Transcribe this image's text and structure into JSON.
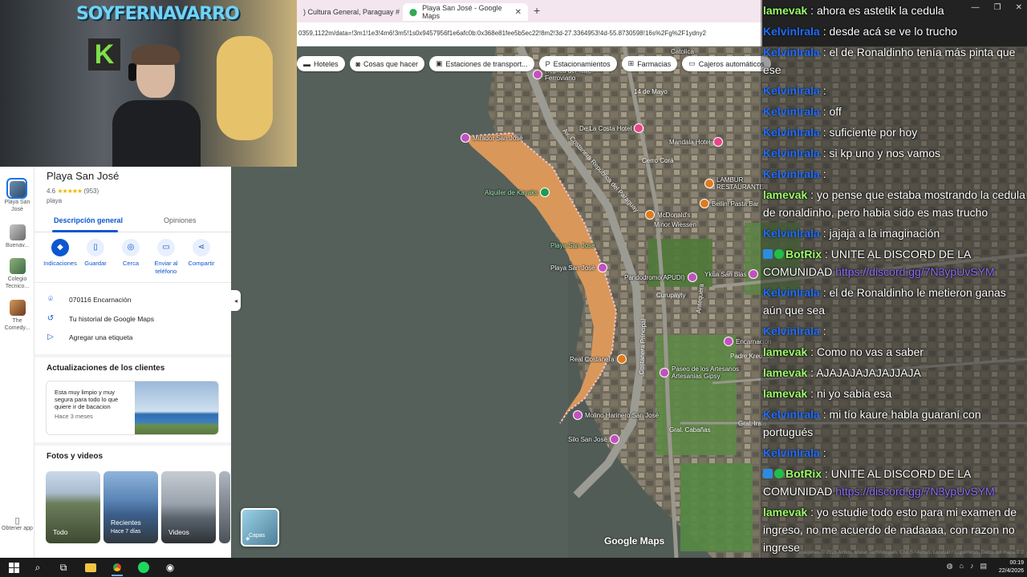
{
  "browser": {
    "tabs": [
      {
        "label": ") Cultura General, Paraguay #"
      },
      {
        "label": "Playa San José - Google Maps"
      }
    ],
    "url": "0359,1122m/data=!3m1!1e3!4m6!3m5!1s0x9457956f1e6afc0b:0x368e81fee5b5ec22!8m2!3d-27.3364953!4d-55.8730598!16s%2Fg%2F1ydny2"
  },
  "chips": [
    {
      "icon": "bed-icon",
      "label": "Hoteles"
    },
    {
      "icon": "camera-icon",
      "label": "Cosas que hacer"
    },
    {
      "icon": "transit-icon",
      "label": "Estaciones de transport..."
    },
    {
      "icon": "parking-icon",
      "label": "Estacionamientos"
    },
    {
      "icon": "pharmacy-icon",
      "label": "Farmacias"
    },
    {
      "icon": "atm-icon",
      "label": "Cajeros automáticos"
    }
  ],
  "webcam": {
    "graffiti": "SOYFERNAVARRO",
    "letter": "K"
  },
  "rail": [
    {
      "label": "Playa San José"
    },
    {
      "label": "Buenav..."
    },
    {
      "label": "Colegio Tecnico..."
    },
    {
      "label": "The Comedy..."
    },
    {
      "label": "Obtener app"
    }
  ],
  "place": {
    "title": "Playa San José",
    "rating": "4.6",
    "stars": "★★★★★",
    "reviews": "(953)",
    "type": "playa",
    "tabs": [
      "Descripción general",
      "Opiniones"
    ],
    "actions": [
      "Indicaciones",
      "Guardar",
      "Cerca",
      "Enviar al teléfono",
      "Compartir"
    ],
    "address": "070116 Encarnación",
    "history": "Tu historial de Google Maps",
    "label_action": "Agregar una etiqueta",
    "updates_heading": "Actualizaciones de los clientes",
    "review_text": "Esta muy limpio y muy segura para todo lo que quiere ir de bacacion",
    "review_time": "Hace 3 meses",
    "photos_heading": "Fotos y videos",
    "photos": [
      {
        "label": "Todo",
        "sub": ""
      },
      {
        "label": "Recientes",
        "sub": "Hace 7 días"
      },
      {
        "label": "Videos",
        "sub": ""
      }
    ]
  },
  "map": {
    "pois": [
      {
        "label": "Mirador San José"
      },
      {
        "label": "De La Costa Hotel"
      },
      {
        "label": "Mandala Hotel"
      },
      {
        "label": "Alquiler de Kayaks"
      },
      {
        "label": "LAMBUR RESTAURANTE"
      },
      {
        "label": "Bellini Pasta Bar"
      },
      {
        "label": "McDonald's"
      },
      {
        "label": "Minor Wiessen"
      },
      {
        "label": "Playa San José"
      },
      {
        "label": "Pandodromo(APUDI)"
      },
      {
        "label": "Ykua San Blas"
      },
      {
        "label": "Real Costanera"
      },
      {
        "label": "Paseo de los Artesanos Artesanias Gipsy"
      },
      {
        "label": "Encarnación"
      },
      {
        "label": "Molino Harinero San José"
      },
      {
        "label": "Silo San José"
      },
      {
        "label": "Catolica"
      },
      {
        "label": "Réplica del Taller Ferroviario"
      }
    ],
    "streets": [
      "Av. Costanera República del Paraguay",
      "14 de Mayo",
      "Cerro Corá",
      "Curupayty",
      "Costanera Principal",
      "Padre Kreusser",
      "Gral. Cabañas",
      "Antequera",
      "Gral. Irala"
    ],
    "brand": "Google Maps",
    "attribution": "Imágenes © 2026 Airbus, Maxar Technologies, CNES / Airbus, Landsat / Copernicus, Datos del mapa © 2",
    "layers": "Capas"
  },
  "chat": {
    "messages": [
      {
        "user": "lamevak",
        "color": "green",
        "text": "ahora es astetik la cedula"
      },
      {
        "user": "Kelvinlrala",
        "color": "blue",
        "text": "desde acá se ve lo trucho"
      },
      {
        "user": "Kelvinlrala",
        "color": "blue",
        "text": "el de Ronaldinho tenía más pinta que ese"
      },
      {
        "user": "Kelvinlrala",
        "color": "blue",
        "text": ""
      },
      {
        "user": "Kelvinlrala",
        "color": "blue",
        "text": "off"
      },
      {
        "user": "Kelvinlrala",
        "color": "blue",
        "text": "suficiente por hoy"
      },
      {
        "user": "Kelvinlrala",
        "color": "blue",
        "text": "si kp uno y nos vamos"
      },
      {
        "user": "Kelvinlrala",
        "color": "blue",
        "text": ""
      },
      {
        "user": "lamevak",
        "color": "green",
        "text": "yo pense que estaba mostrando la cedula de ronaldinho, pero habia sido es mas trucho"
      },
      {
        "user": "Kelvinlrala",
        "color": "blue",
        "text": "jajaja a la imaginación"
      },
      {
        "user": "BotRix",
        "color": "bot",
        "text": "UNITE AL DISCORD DE LA COMUNIDAD ",
        "link": "https://discord.gg/7N3ypUvSYM"
      },
      {
        "user": "Kelvinlrala",
        "color": "blue",
        "text": "el de Ronaldinho le metieron ganas aún que sea"
      },
      {
        "user": "Kelvinlrala",
        "color": "blue",
        "text": ""
      },
      {
        "user": "lamevak",
        "color": "green",
        "text": "Como no vas a saber"
      },
      {
        "user": "lamevak",
        "color": "green",
        "text": "AJAJAJAJAJAJJAJA"
      },
      {
        "user": "lamevak",
        "color": "green",
        "text": "ni yo sabia esa"
      },
      {
        "user": "Kelvinlrala",
        "color": "blue",
        "text": "mi tío kaure habla guaraní con portugués"
      },
      {
        "user": "Kelvinlrala",
        "color": "blue",
        "text": ""
      },
      {
        "user": "BotRix",
        "color": "bot",
        "text": "UNITE AL DISCORD DE LA COMUNIDAD ",
        "link": "https://discord.gg/7N3ypUvSYM"
      },
      {
        "user": "lamevak",
        "color": "green",
        "text": "yo estudie todo esto para mi examen de ingreso, no me acuerdo de nadaaaa, con razon no ingrese"
      }
    ]
  },
  "taskbar": {
    "time": "00:19",
    "date": "22/4/2026"
  }
}
